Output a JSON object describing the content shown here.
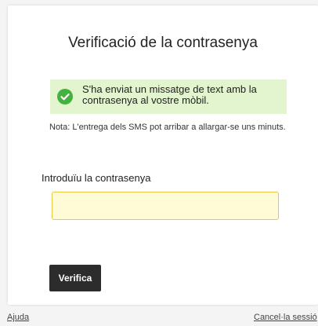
{
  "title": "Verificació de la contrasenya",
  "success": {
    "message": "S'ha enviat un missatge de text amb la contrasenya al vostre mòbil.",
    "icon": "check-circle-icon",
    "icon_color": "#45b13f",
    "background": "#e3f5cf"
  },
  "note": "Nota: L'entrega dels SMS pot arribar a allargar-se uns minuts.",
  "password": {
    "label": "Introduïu la contrasenya",
    "value": ""
  },
  "verify_button": "Verifica",
  "footer": {
    "help": "Ajuda",
    "cancel": "Cancel·la sessió"
  }
}
